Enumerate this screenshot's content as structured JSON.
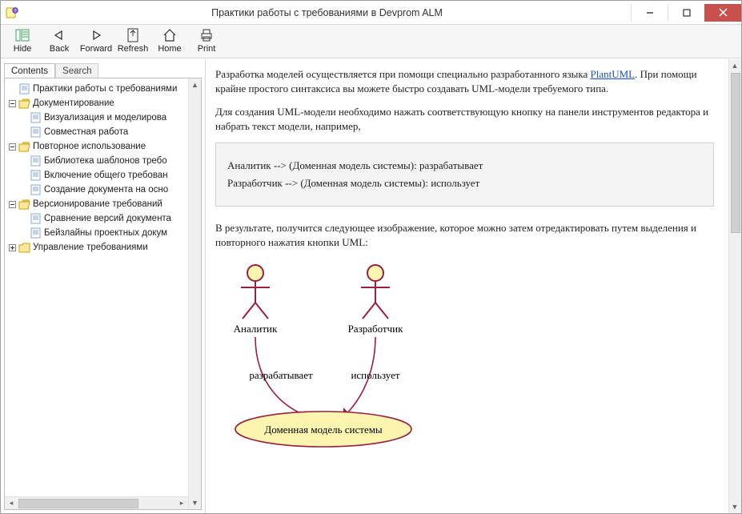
{
  "window": {
    "title": "Практики работы с требованиями в Devprom ALM"
  },
  "toolbar": {
    "hide": "Hide",
    "back": "Back",
    "forward": "Forward",
    "refresh": "Refresh",
    "home": "Home",
    "print": "Print"
  },
  "tabs": {
    "contents": "Contents",
    "search": "Search"
  },
  "tree": {
    "n0": "Практики работы с требованиями",
    "n1": "Документирование",
    "n2": "Визуализация и моделирова",
    "n3": "Совместная работа",
    "n4": "Повторное использование",
    "n5": "Библиотека шаблонов требо",
    "n6": "Включение общего требован",
    "n7": "Создание документа на осно",
    "n8": "Версионирование требований",
    "n9": "Сравнение версий документа",
    "n10": "Бейзлайны проектных докум",
    "n11": "Управление требованиями"
  },
  "content": {
    "p1a": "Разработка моделей осуществляется при помощи специально разработанного языка ",
    "p1link": "PlantUML",
    "p1b": ". При помощи крайне простого синтаксиса вы можете быстро создавать UML-модели требуемого типа.",
    "p2": "Для создания UML-модели необходимо нажать соответствующую кнопку на панели инструментов редактора и набрать текст модели, например,",
    "code1": "Аналитик --> (Доменная модель системы): разрабатывает",
    "code2": "Разработчик --> (Доменная модель системы): использует",
    "p3": "В результате, получится следующее изображение, которое можно затем отредактировать путем выделения и повторного нажатия кнопки UML:",
    "actor1": "Аналитик",
    "actor2": "Разработчик",
    "rel1": "разрабатывает",
    "rel2": "использует",
    "usecase": "Доменная модель системы"
  }
}
